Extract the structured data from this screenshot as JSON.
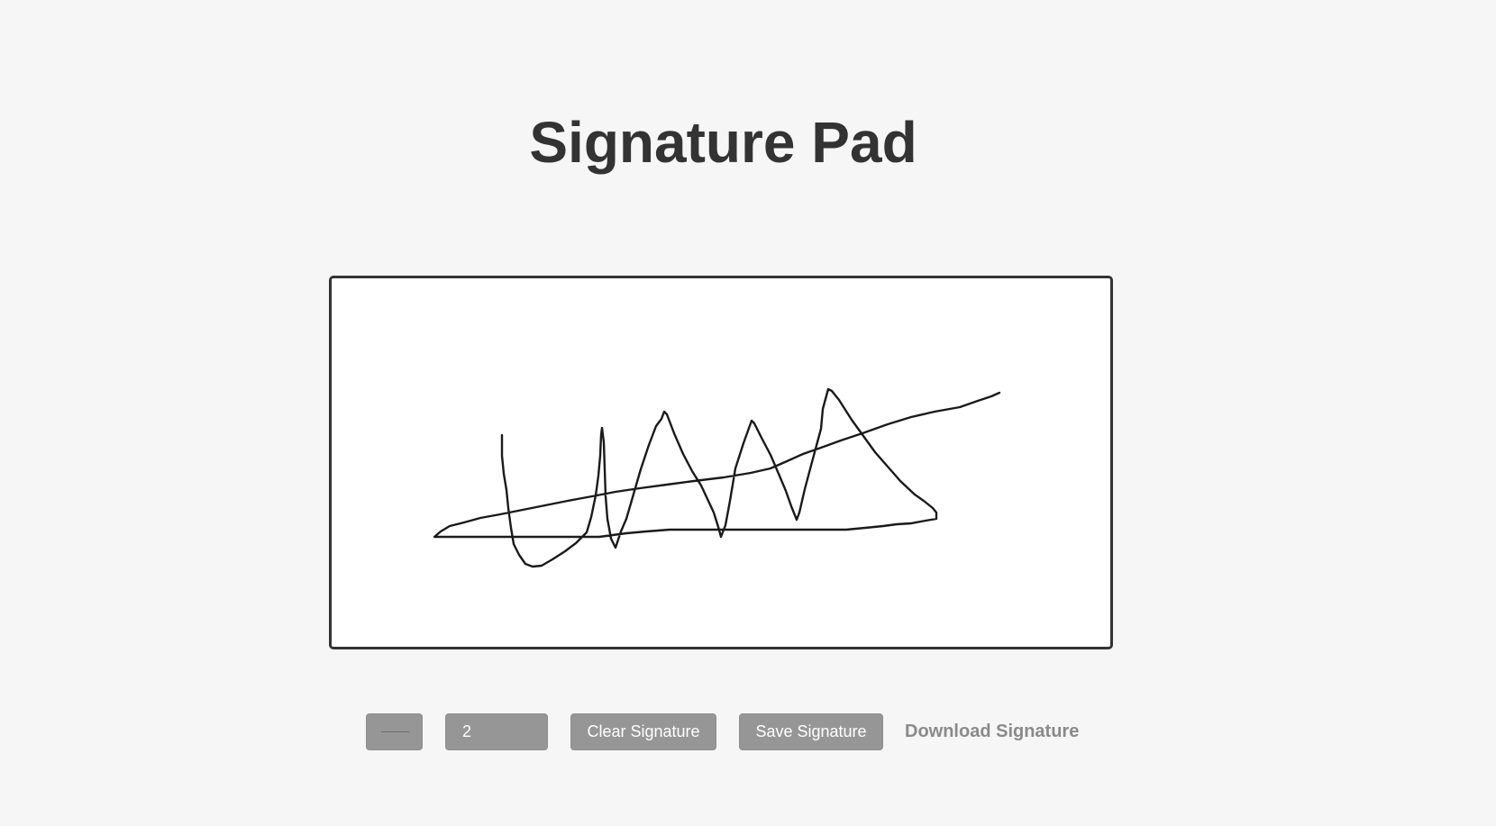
{
  "page": {
    "title": "Signature Pad"
  },
  "signature_pad": {
    "ink_color": "#1a1a1a",
    "background_color": "#ffffff"
  },
  "controls": {
    "pen_color": "#6e6e6e",
    "pen_width": "2",
    "clear_label": "Clear Signature",
    "save_label": "Save Signature",
    "download_label": "Download Signature"
  }
}
